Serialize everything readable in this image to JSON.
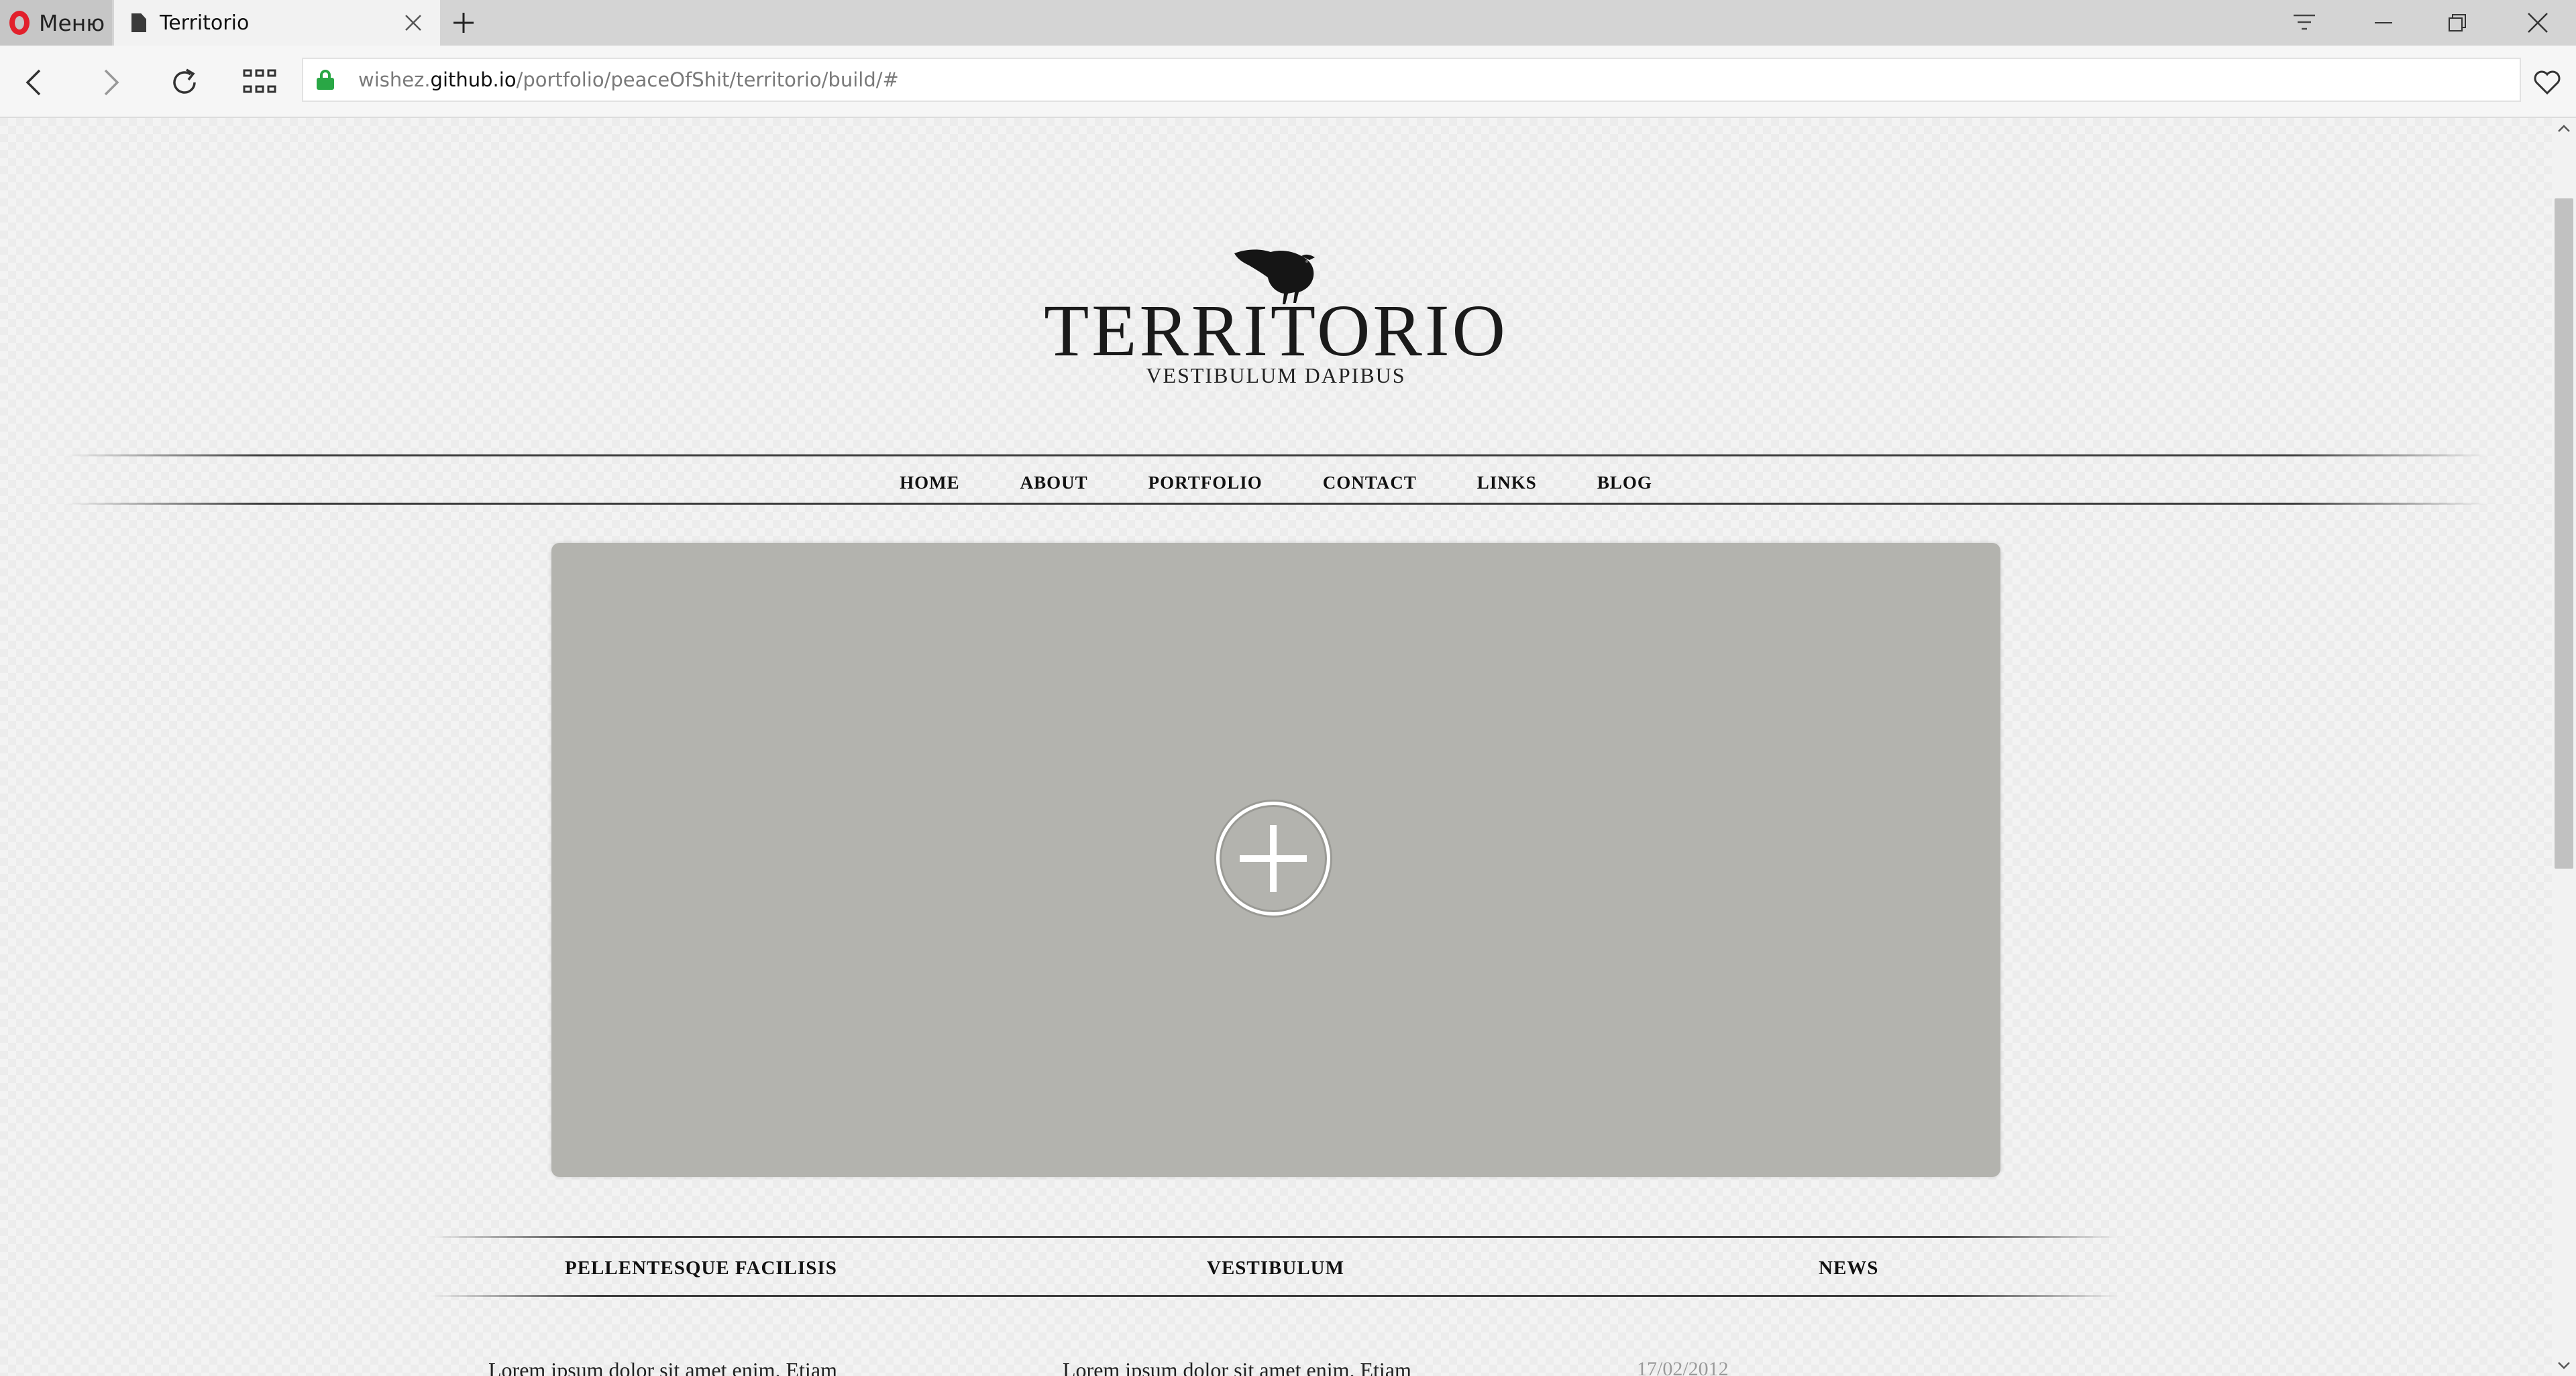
{
  "browser": {
    "menu_label": "Меню",
    "tab_title": "Territorio",
    "url_prefix": "wishez.",
    "url_host": "github.io",
    "url_path": "/portfolio/peaceOfShit/territorio/build/#",
    "colors": {
      "opera_red": "#e2202b",
      "lock_green": "#29a745"
    }
  },
  "site": {
    "title": "TERRITORIO",
    "tagline": "VESTIBULUM DAPIBUS",
    "logo_icon": "crow-icon",
    "nav": [
      "HOME",
      "ABOUT",
      "PORTFOLIO",
      "CONTACT",
      "LINKS",
      "BLOG"
    ]
  },
  "slider": {
    "button_icon": "plus-circle-icon"
  },
  "columns": [
    {
      "heading": "PELLENTESQUE FACILISIS",
      "text": "Lorem ipsum dolor sit amet enim. Etiam"
    },
    {
      "heading": "VESTIBULUM",
      "text": "Lorem ipsum dolor sit amet enim. Etiam"
    },
    {
      "heading": "NEWS",
      "date": "17/02/2012"
    }
  ]
}
